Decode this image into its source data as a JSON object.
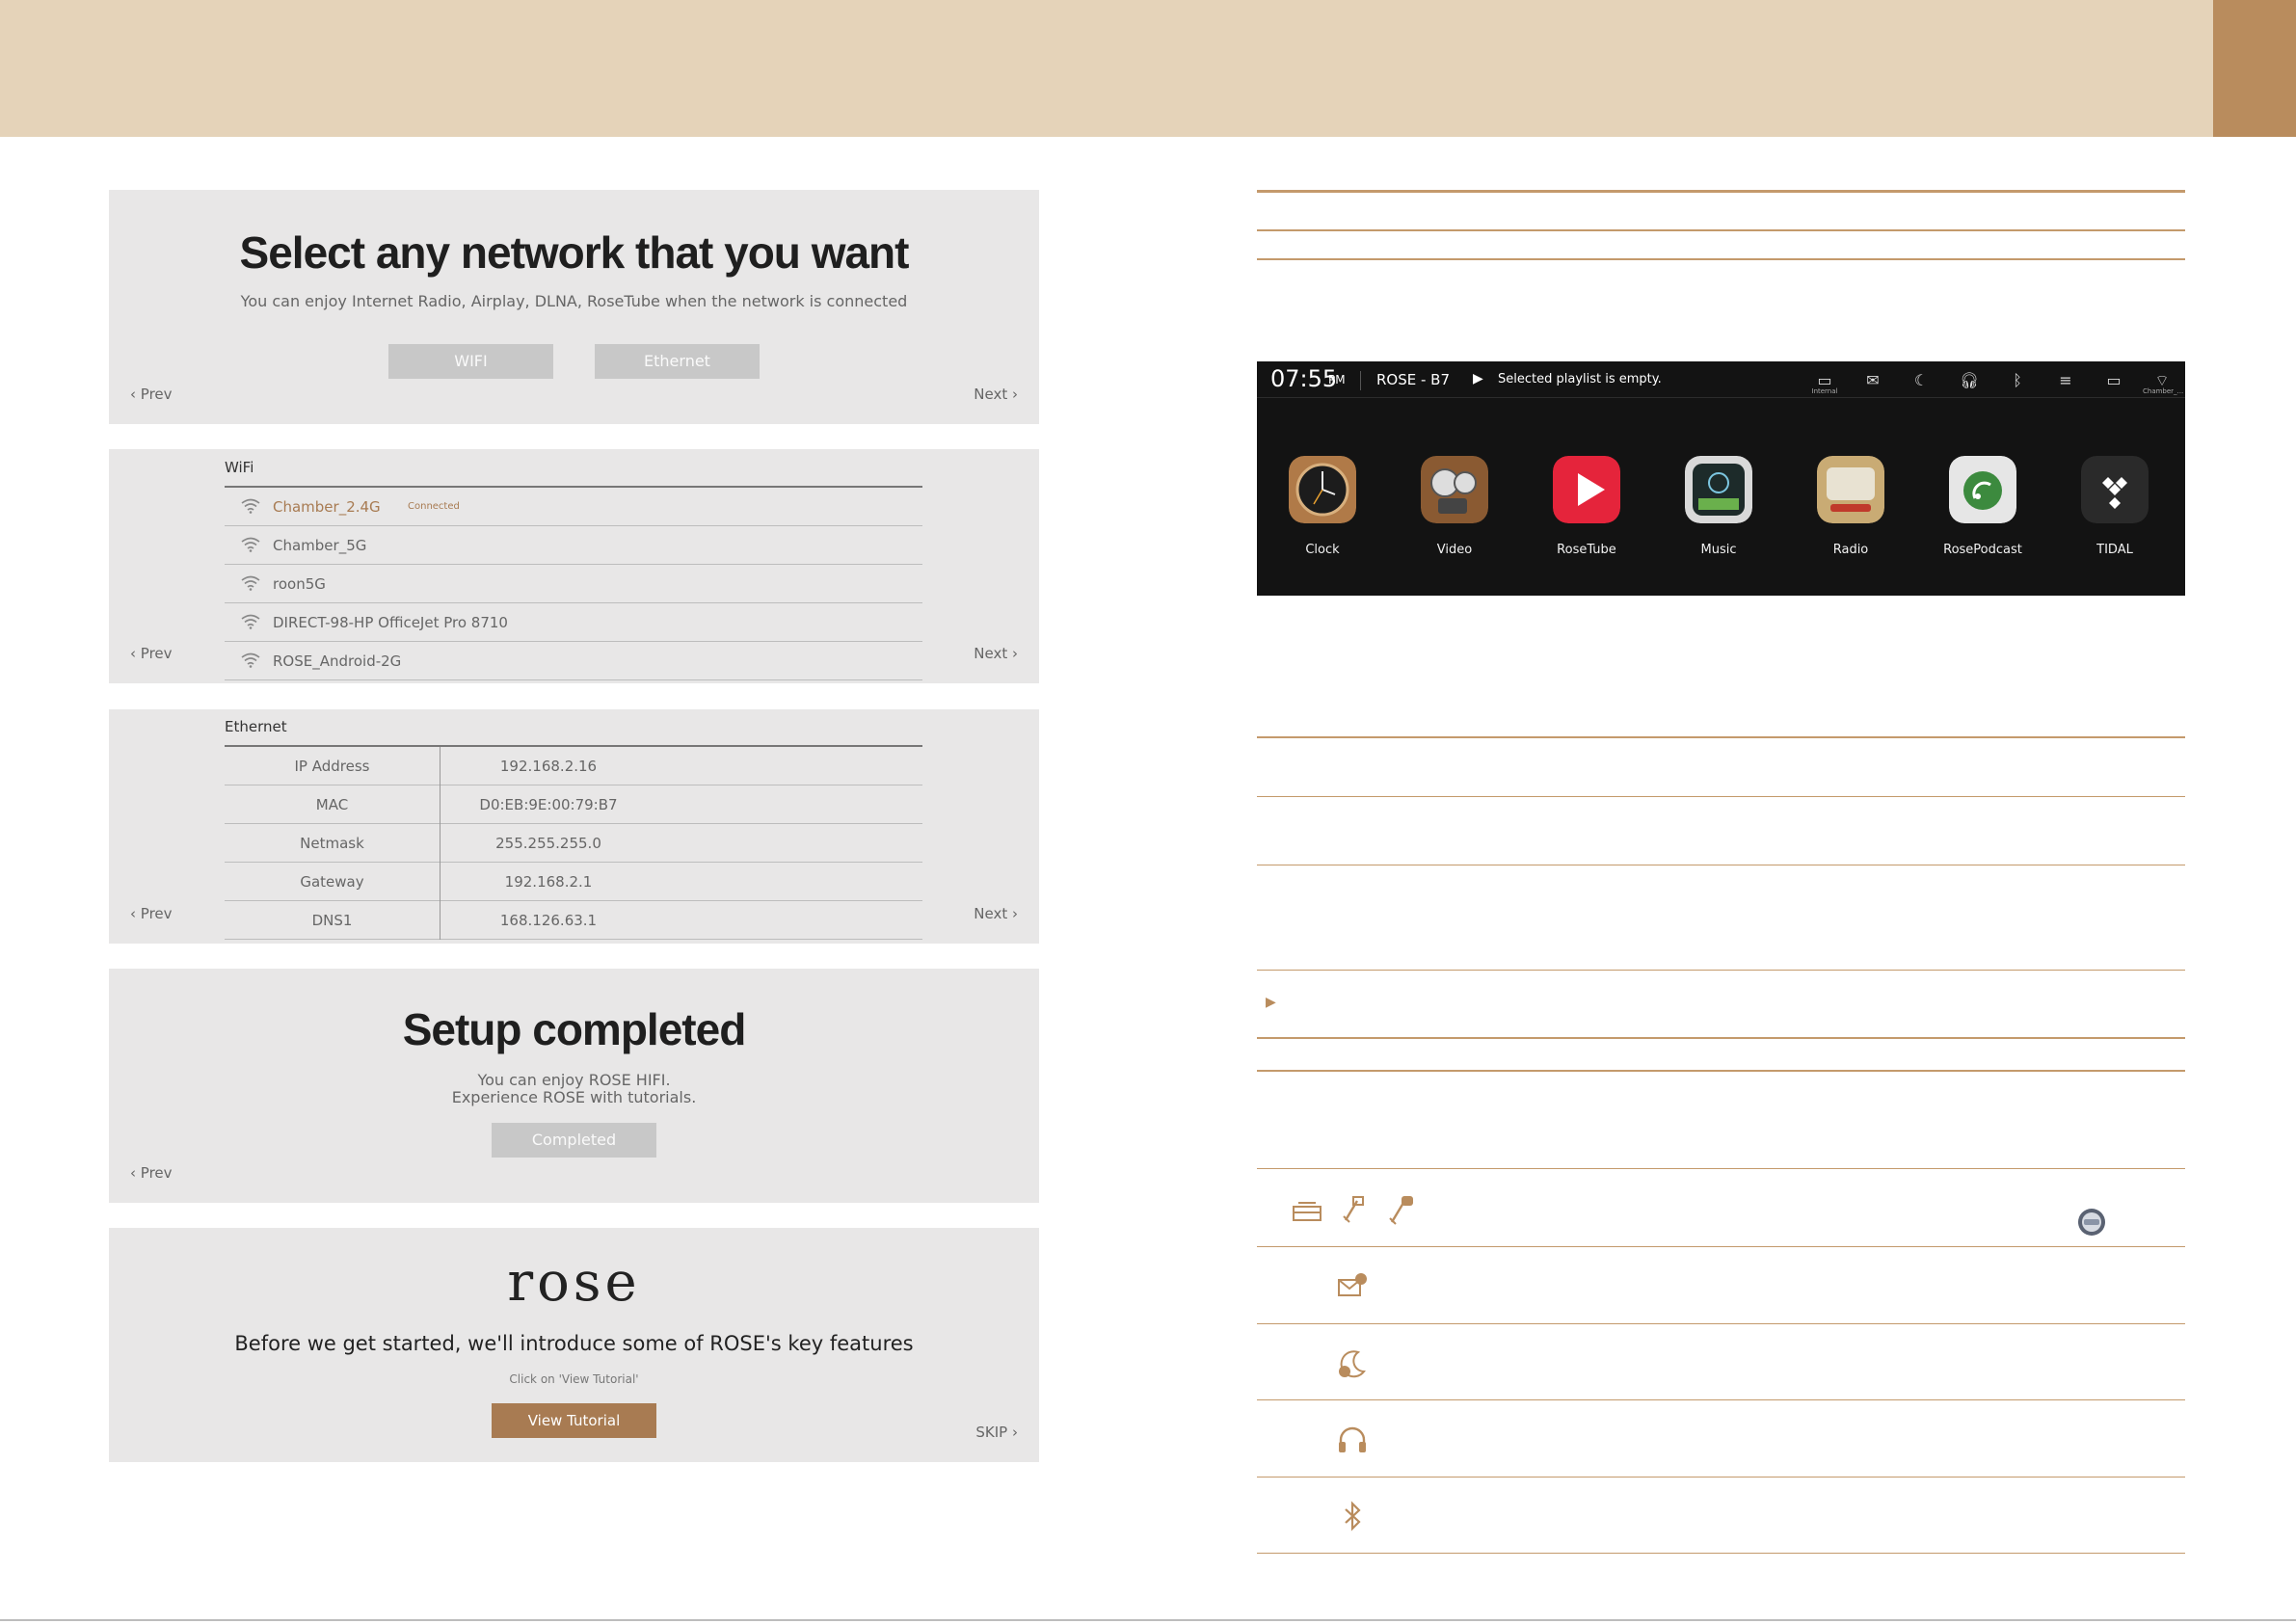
{
  "setup": {
    "network": {
      "title": "Select any network that you want",
      "subtitle": "You can enjoy Internet Radio, Airplay, DLNA, RoseTube when the network is connected",
      "wifi_button": "WIFI",
      "ethernet_button": "Ethernet",
      "prev": "Prev",
      "next": "Next"
    },
    "wifi_list": {
      "title": "WiFi",
      "prev": "Prev",
      "next": "Next",
      "connected_label": "Connected",
      "networks": [
        "Chamber_2.4G",
        "Chamber_5G",
        "roon5G",
        "DIRECT-98-HP OfficeJet Pro 8710",
        "ROSE_Android-2G"
      ]
    },
    "ethernet": {
      "title": "Ethernet",
      "prev": "Prev",
      "next": "Next",
      "rows": [
        {
          "key": "IP Address",
          "value": "192.168.2.16"
        },
        {
          "key": "MAC",
          "value": "D0:EB:9E:00:79:B7"
        },
        {
          "key": "Netmask",
          "value": "255.255.255.0"
        },
        {
          "key": "Gateway",
          "value": "192.168.2.1"
        },
        {
          "key": "DNS1",
          "value": "168.126.63.1"
        }
      ]
    },
    "completed": {
      "title": "Setup completed",
      "line1": "You can enjoy ROSE HIFI.",
      "line2": "Experience ROSE with tutorials.",
      "button": "Completed",
      "prev": "Prev"
    },
    "intro": {
      "logo": "rose",
      "headline": "Before we get started, we'll introduce some of ROSE's key features",
      "hint": "Click on 'View Tutorial'",
      "button": "View Tutorial",
      "skip": "SKIP"
    }
  },
  "device": {
    "time": "07:55",
    "ampm": "PM",
    "name": "ROSE - B7",
    "playlist": "Selected playlist is empty.",
    "storage_label": "Internal",
    "wifi_label": "Chamber_...",
    "apps": [
      "Clock",
      "Video",
      "RoseTube",
      "Music",
      "Radio",
      "RosePodcast",
      "TIDAL"
    ]
  },
  "colors": {
    "band": "#e5d3b9",
    "accent": "#b98c5d",
    "panel": "#e8e7e7",
    "brown_button": "#a87b52"
  },
  "icons": [
    "storage-icon",
    "usb-icon",
    "usb-c-icon",
    "message-icon",
    "sleep-timer-icon",
    "headphone-icon",
    "bluetooth-icon",
    "disc-icon"
  ]
}
